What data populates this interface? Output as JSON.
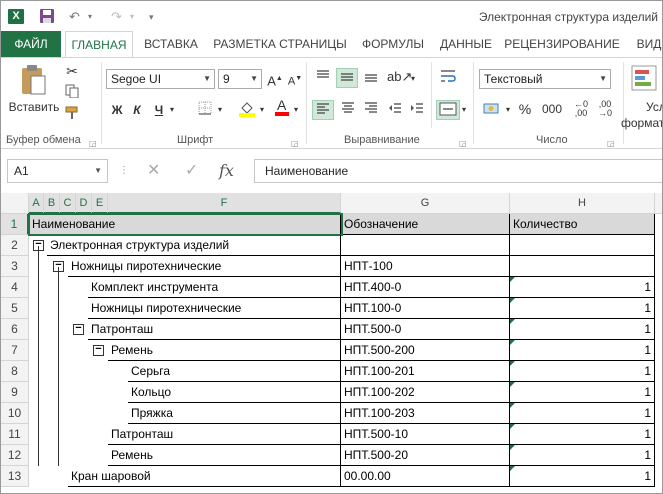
{
  "titlebar": {
    "app_icon": "X",
    "title": "Электронная структура изделий"
  },
  "tabs": [
    "ФАЙЛ",
    "ГЛАВНАЯ",
    "ВСТАВКА",
    "РАЗМЕТКА СТРАНИЦЫ",
    "ФОРМУЛЫ",
    "ДАННЫЕ",
    "РЕЦЕНЗИРОВАНИЕ",
    "ВИД"
  ],
  "ribbon": {
    "paste_label": "Вставить",
    "clipboard_group": "Буфер обмена",
    "font_name": "Segoe UI",
    "font_size": "9",
    "font_group": "Шрифт",
    "bold": "Ж",
    "italic": "К",
    "underline": "Ч",
    "align_group": "Выравнивание",
    "number_format": "Текстовый",
    "number_group": "Число",
    "percent": "%",
    "comma": "000",
    "cut_icon": "scissors-icon",
    "copy_icon": "copy-icon",
    "brush_icon": "format-painter-icon",
    "truncated_right1": "Усл",
    "truncated_right2": "формат"
  },
  "formula_bar": {
    "name_box": "A1",
    "fx": "fx",
    "value": "Наименование"
  },
  "columns": [
    "A",
    "B",
    "C",
    "D",
    "E",
    "F",
    "G",
    "H"
  ],
  "rows": [
    "1",
    "2",
    "3",
    "4",
    "5",
    "6",
    "7",
    "8",
    "9",
    "10",
    "11",
    "12",
    "13"
  ],
  "headers": {
    "name": "Наименование",
    "designation": "Обозначение",
    "quantity": "Количество"
  },
  "items": [
    {
      "name": "Электронная структура изделий",
      "code": "",
      "qty": "",
      "toggle": "minus"
    },
    {
      "name": "Ножницы пиротехнические",
      "code": "НПТ-100",
      "qty": "",
      "toggle": "minus"
    },
    {
      "name": "Комплект инструмента",
      "code": "НПТ.400-0",
      "qty": "1",
      "toggle": ""
    },
    {
      "name": "Ножницы пиротехнические",
      "code": "НПТ.100-0",
      "qty": "1",
      "toggle": ""
    },
    {
      "name": "Патронташ",
      "code": "НПТ.500-0",
      "qty": "1",
      "toggle": "minus"
    },
    {
      "name": "Ремень",
      "code": "НПТ.500-200",
      "qty": "1",
      "toggle": "minus"
    },
    {
      "name": "Серьга",
      "code": "НПТ.100-201",
      "qty": "1",
      "toggle": ""
    },
    {
      "name": "Кольцо",
      "code": "НПТ.100-202",
      "qty": "1",
      "toggle": ""
    },
    {
      "name": "Пряжка",
      "code": "НПТ.100-203",
      "qty": "1",
      "toggle": ""
    },
    {
      "name": "Патронташ",
      "code": "НПТ.500-10",
      "qty": "1",
      "toggle": ""
    },
    {
      "name": "Ремень",
      "code": "НПТ.500-20",
      "qty": "1",
      "toggle": ""
    },
    {
      "name": "Кран шаровой",
      "code": "00.00.00",
      "qty": "1",
      "toggle": ""
    }
  ],
  "colors": {
    "accent": "#217346",
    "selection": "#217346"
  }
}
